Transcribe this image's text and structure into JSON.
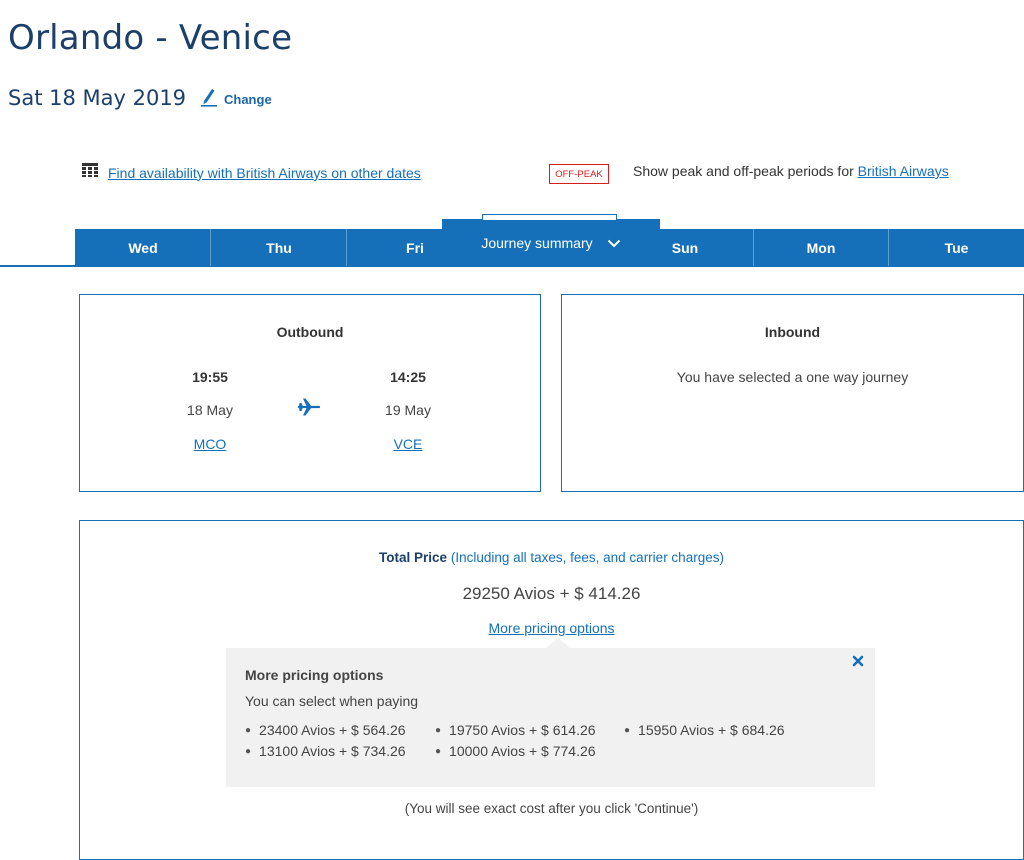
{
  "header": {
    "title": "Orlando - Venice",
    "date": "Sat 18 May 2019",
    "change_label": "Change"
  },
  "availability": {
    "link_text": "Find availability with British Airways on other dates",
    "offpeak_badge": "OFF-PEAK",
    "peak_text": "Show peak and off-peak periods for",
    "peak_link": "British Airways"
  },
  "tabs": {
    "left": [
      "Wed",
      "Thu",
      "Fri"
    ],
    "right": [
      "Sun",
      "Mon",
      "Tue"
    ],
    "journey_summary": "Journey summary"
  },
  "outbound": {
    "heading": "Outbound",
    "depart_time": "19:55",
    "depart_date": "18 May",
    "depart_code": "MCO",
    "arrive_time": "14:25",
    "arrive_date": "19 May",
    "arrive_code": "VCE"
  },
  "inbound": {
    "heading": "Inbound",
    "message": "You have selected a one way journey"
  },
  "price": {
    "label": "Total Price",
    "note": "(Including all taxes, fees, and carrier charges)",
    "amount": "29250 Avios + $ 414.26",
    "more_link": "More pricing options",
    "footer": "(You will see exact cost after you click 'Continue')"
  },
  "popup": {
    "title": "More pricing options",
    "subtitle": "You can select when paying",
    "options": [
      "23400 Avios + $ 564.26",
      "19750 Avios + $ 614.26",
      "15950 Avios + $ 684.26",
      "13100 Avios + $ 734.26",
      "10000 Avios + $ 774.26"
    ]
  },
  "colors": {
    "brand_blue": "#1570b9",
    "title_navy": "#1b3f6b",
    "offpeak_red": "#d21f1f"
  },
  "icons": [
    "pencil-icon",
    "calendar-grid-icon",
    "chevron-down-icon",
    "plane-icon",
    "close-icon"
  ]
}
